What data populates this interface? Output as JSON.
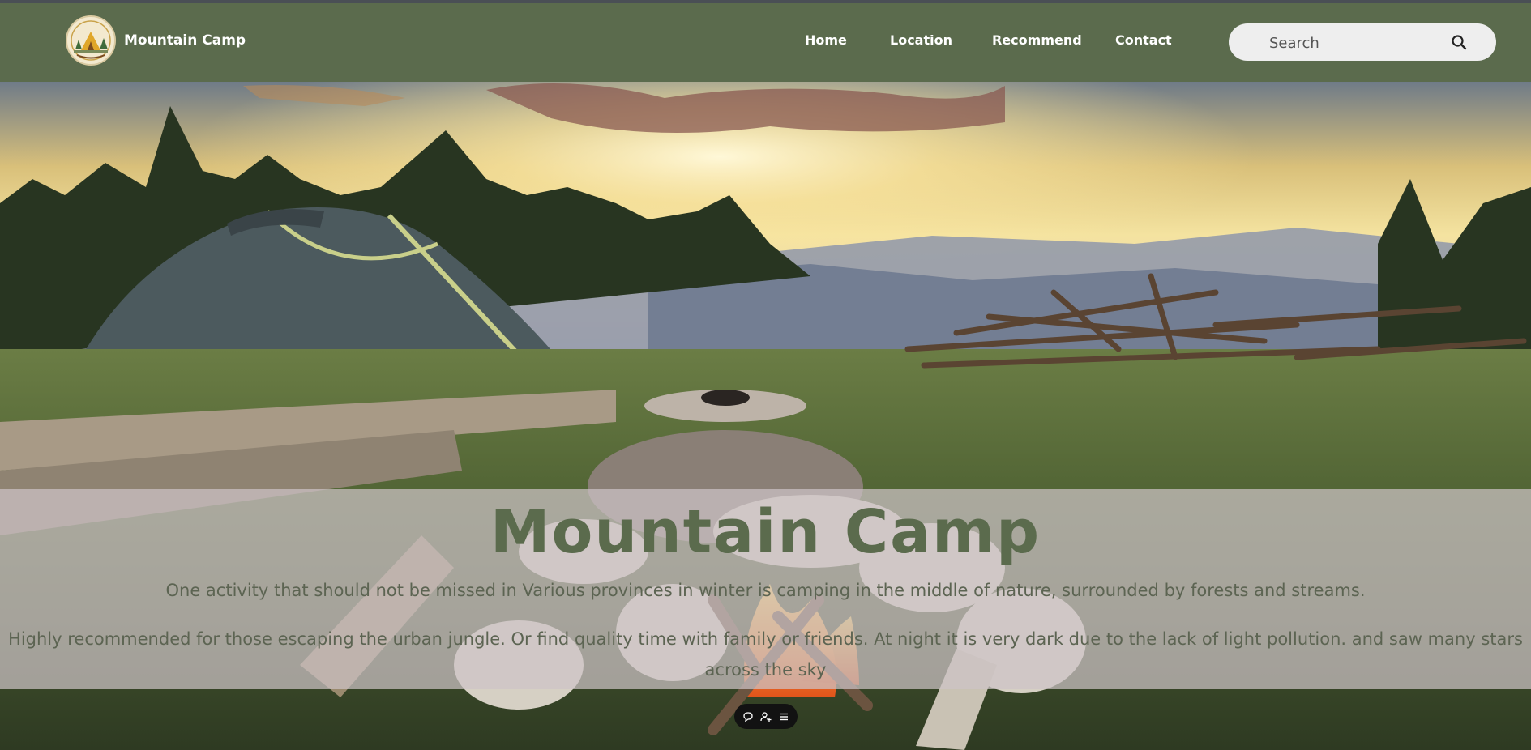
{
  "site": {
    "brand": "Mountain Camp"
  },
  "nav": {
    "items": [
      {
        "label": "Home"
      },
      {
        "label": "Location"
      },
      {
        "label": "Recommend"
      },
      {
        "label": "Contact"
      }
    ]
  },
  "search": {
    "placeholder": "Search",
    "icon": "search-icon"
  },
  "hero": {
    "title": "Mountain Camp",
    "paragraph1": "One activity that should not be missed in Various provinces in winter is camping in the middle of nature, surrounded by forests and streams.",
    "paragraph2": "Highly recommended for those escaping the urban jungle. Or find quality time with family or friends. At night it is very dark due to the lack of light pollution. and saw many stars across the sky"
  },
  "floating_toolbar": {
    "icons": [
      "comment-icon",
      "add-user-icon",
      "menu-icon"
    ]
  },
  "colors": {
    "navbar": "#5b6b4d",
    "title": "#5b6b4d",
    "overlay": "#cdc3c6",
    "search_bg": "#eeeeee"
  }
}
